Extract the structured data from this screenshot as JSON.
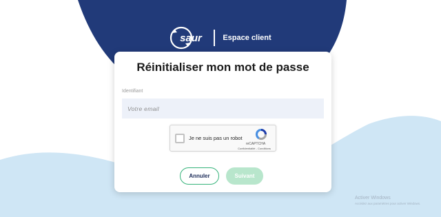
{
  "brand": {
    "logo_text": "saur",
    "portal_label": "Espace client"
  },
  "form": {
    "title": "Réinitialiser mon mot de passe",
    "identifier_label": "Identifiant",
    "email_placeholder": "Votre email",
    "email_value": ""
  },
  "captcha": {
    "label": "Je ne suis pas un robot",
    "brand": "reCAPTCHA",
    "privacy_link": "Confidentialité",
    "links_separator": " - ",
    "terms_link": "Conditions"
  },
  "buttons": {
    "cancel_label": "Annuler",
    "next_label": "Suivant"
  },
  "watermark": {
    "title": "Activer Windows",
    "subtitle": "Accédez aux paramètres pour activer Windows."
  },
  "colors": {
    "navy": "#213a79",
    "light_blue": "#cfe6f5",
    "green": "#35b37a",
    "green_disabled": "#b8e6cc",
    "input_bg": "#edf1f9"
  }
}
